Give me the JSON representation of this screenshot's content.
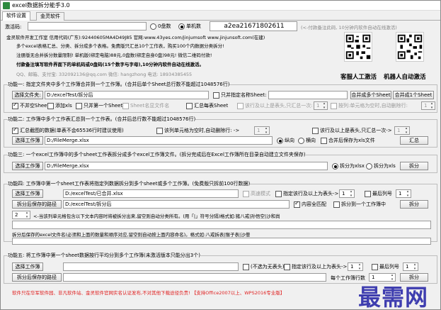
{
  "window": {
    "title": "excel数据拆分能手3.0"
  },
  "tabs": [
    {
      "label": "软件设置"
    },
    {
      "label": "金灵软件"
    }
  ],
  "registration": {
    "label": "激活码:",
    "code_placeholder": "",
    "radio_trial": "0盘数",
    "radio_single": "单机数",
    "machine_code": "a2ea21671802611",
    "machine_note": "(<-付款备注此码, 10分钟内软件自动在线激活)"
  },
  "about": {
    "line1": "金灵软件开发工作室 信用代码(广东):92440605MA4D49J85 官网:www.43yes.com/jinjumsoft www.jinjunsoft.com(在建)",
    "line2": "多个excel表格汇总、分类、拆分成多个表格。免费版只汇总10个工作表，购买100个内数据分类拆分!",
    "line3": "注册版无合并拆分数量限制! 单机版(绑定电脑)88元,0盘数(绑定自身0盘)98元! 微信二维码付款!",
    "line4": "付款备注填写软件界面下的单机码或0盘码(15个数字与字母),10分钟内软件自动在线激活。",
    "line5": "QQ、邮箱、支付宝: 332092136@qq.com    微信: hangzhong    电话: 18934385455"
  },
  "qr_captions": {
    "left": "客服人工激活",
    "right": "机器人自动激活"
  },
  "f1": {
    "title": "功能一: 指定文件夹中多个工作簿合并到一个工作簿。(合并后单个Sheet总行数不能超过1048576行)",
    "select_folder": "选择文件夹:",
    "folder_path": "D:/excelTest/拆分后",
    "only_specified_name": "只并指定名称Sheet:",
    "merge_multi_sheet": "合并成多个Sheet",
    "merge_one_sheet": "合并成1个Sheet",
    "options": [
      "不并空Sheet",
      "添加xls",
      "只并第一个Sheet",
      "Sheet名显文件名",
      "汇总每表Sheet",
      "该行及以上是表头,只汇总一次:",
      "按列:单元格为空时,自动删除行:"
    ],
    "header_rows_value": "1",
    "delete_col_value": "1"
  },
  "f2": {
    "title": "功能二: 工作簿中多个工作表汇总到一个工作表。(合并后总行数不能超过1048576行)",
    "opt_summary_sheet": "汇总截图的数据(单表不会65536行时建议使用)",
    "opt_delete_empty": "该列单元格为空时,自动删除行: ->",
    "delete_col_value": "1",
    "opt_header": "该行及以上是表头,只汇总一次->",
    "header_value": "1",
    "select_workbook": "选择工作簿",
    "file_path": "D:/FileMerge.xlsx",
    "radio_portrait": "纵向",
    "radio_landscape": "横向",
    "opt_save_xls": "合并后保存为xls文件",
    "summary_button": "汇总"
  },
  "f3": {
    "title": "功能三: 一个excel工作簿中的多个sheet工作表拆分成多个excel工作簿文件。(拆分完成后在Excel工作簿所在目录自动建立文件夹保存)",
    "select_workbook": "选择工作簿",
    "file_path": "D:/FileMerge.xlsx",
    "radio_xlsx": "拆分为xlsx",
    "radio_xls": "拆分为xls",
    "split_button": "拆分"
  },
  "f4": {
    "title": "功能四: 工作簿中第一个sheet工作表将指定列数据拆分到多个sheet或多个工作簿。(免费版只拆前100行数据)",
    "select_workbook": "选择工作簿",
    "file_path": "D:/excelTest/已合并.xlsx",
    "opt_advanced": "高速模式",
    "opt_header": "指定该行及以上为表头->",
    "header_value": "1",
    "opt_last_col": "最后列号",
    "last_col_value": "1",
    "save_path_button": "拆分后保存的路径",
    "save_path": "D:/excelTest/拆分后",
    "opt_content_match": "内容全匹配",
    "opt_split_to_wb": "拆分到一个工作簿中",
    "col_value": "2",
    "col_note": "<-当该列单元格包含以下文本内容时将被拆分出来,留空则自动分类所有。(用「|」符号分隔)格式如:猪八戒|孙悟空|沙和尚",
    "filename_note": "拆分后保存的excel文件名(必须和上面的数量和顺序对应,留空则自动按上面内容命名)。格式如:八戒拆表|猴子表|沙僧"
  },
  "f5": {
    "title": "功能五: 将工作簿中第一个sheet数据按行平均分到多个工作簿(未激活版本只能分出3个)",
    "select_workbook": "选择工作簿",
    "save_path_button": "拆分后保存的路径",
    "opt_no_header": "(不选为无表头)",
    "opt_header": "指定该行及以上为表头->",
    "header_value": "1",
    "opt_last_col": "最后列号",
    "last_col_value": "1",
    "rows_per_wb_label": "每个工作簿行数",
    "rows_per_wb_value": "1",
    "split_button": "拆分"
  },
  "footer": "软件只在华军软件园、非凡软件站、金灵软件官网实名认证发布,不对其他下载途径负责! 【支持Office2007以上、WPS2016专业版】",
  "watermark": "最需网",
  "colors": {
    "red": "#e02020",
    "blue": "#1a4bd1",
    "watermark": "#2b2aa8"
  }
}
